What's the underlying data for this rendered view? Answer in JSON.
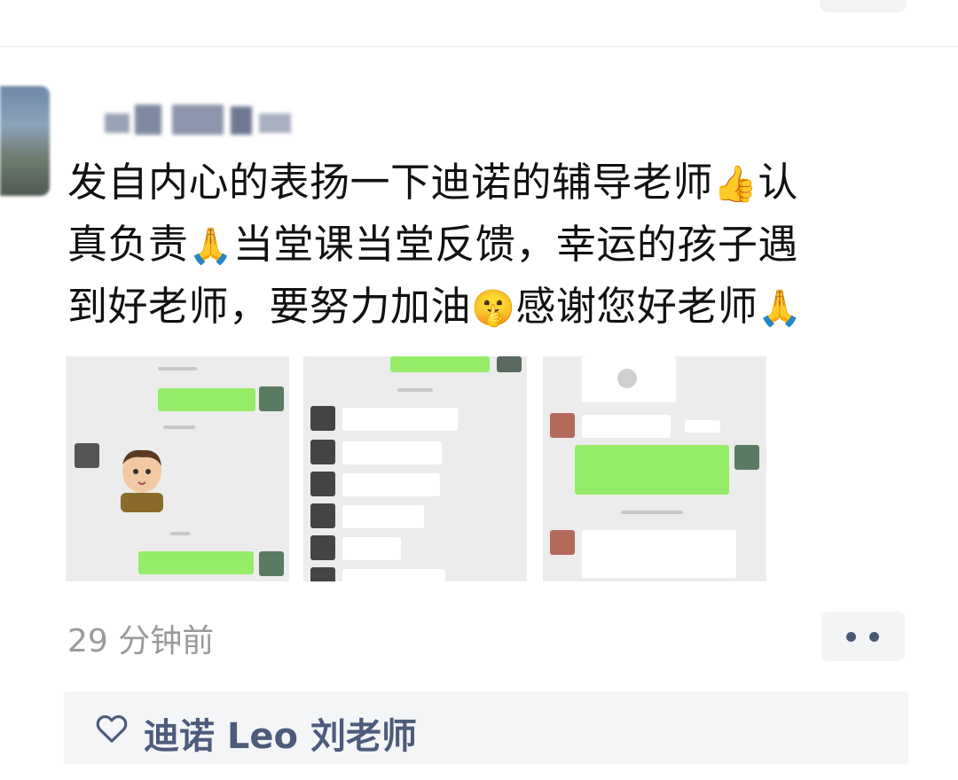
{
  "post": {
    "line1": "发自内心的表扬一下迪诺的辅导老师",
    "line1_end": "认",
    "line2_a": "真负责",
    "line2_b": "当堂课当堂反馈，幸运的孩子遇",
    "line3_a": "到好老师，要努力加油",
    "line3_b": "感谢您好老师",
    "emojis": {
      "thumbs_up": "👍",
      "pray_hands": "🙏",
      "shush_face": "🤫"
    },
    "images": [
      {
        "description_icon": "chat-screenshot-icon"
      },
      {
        "description_icon": "chat-screenshot-icon"
      },
      {
        "description_icon": "chat-screenshot-icon"
      }
    ],
    "time": "29 分钟前"
  },
  "likes": {
    "names": "迪诺 Leo 刘老师"
  },
  "colors": {
    "wechat_green": "#95ec69",
    "link_blue": "#4d5b7c",
    "time_gray": "#9a9a9a"
  }
}
